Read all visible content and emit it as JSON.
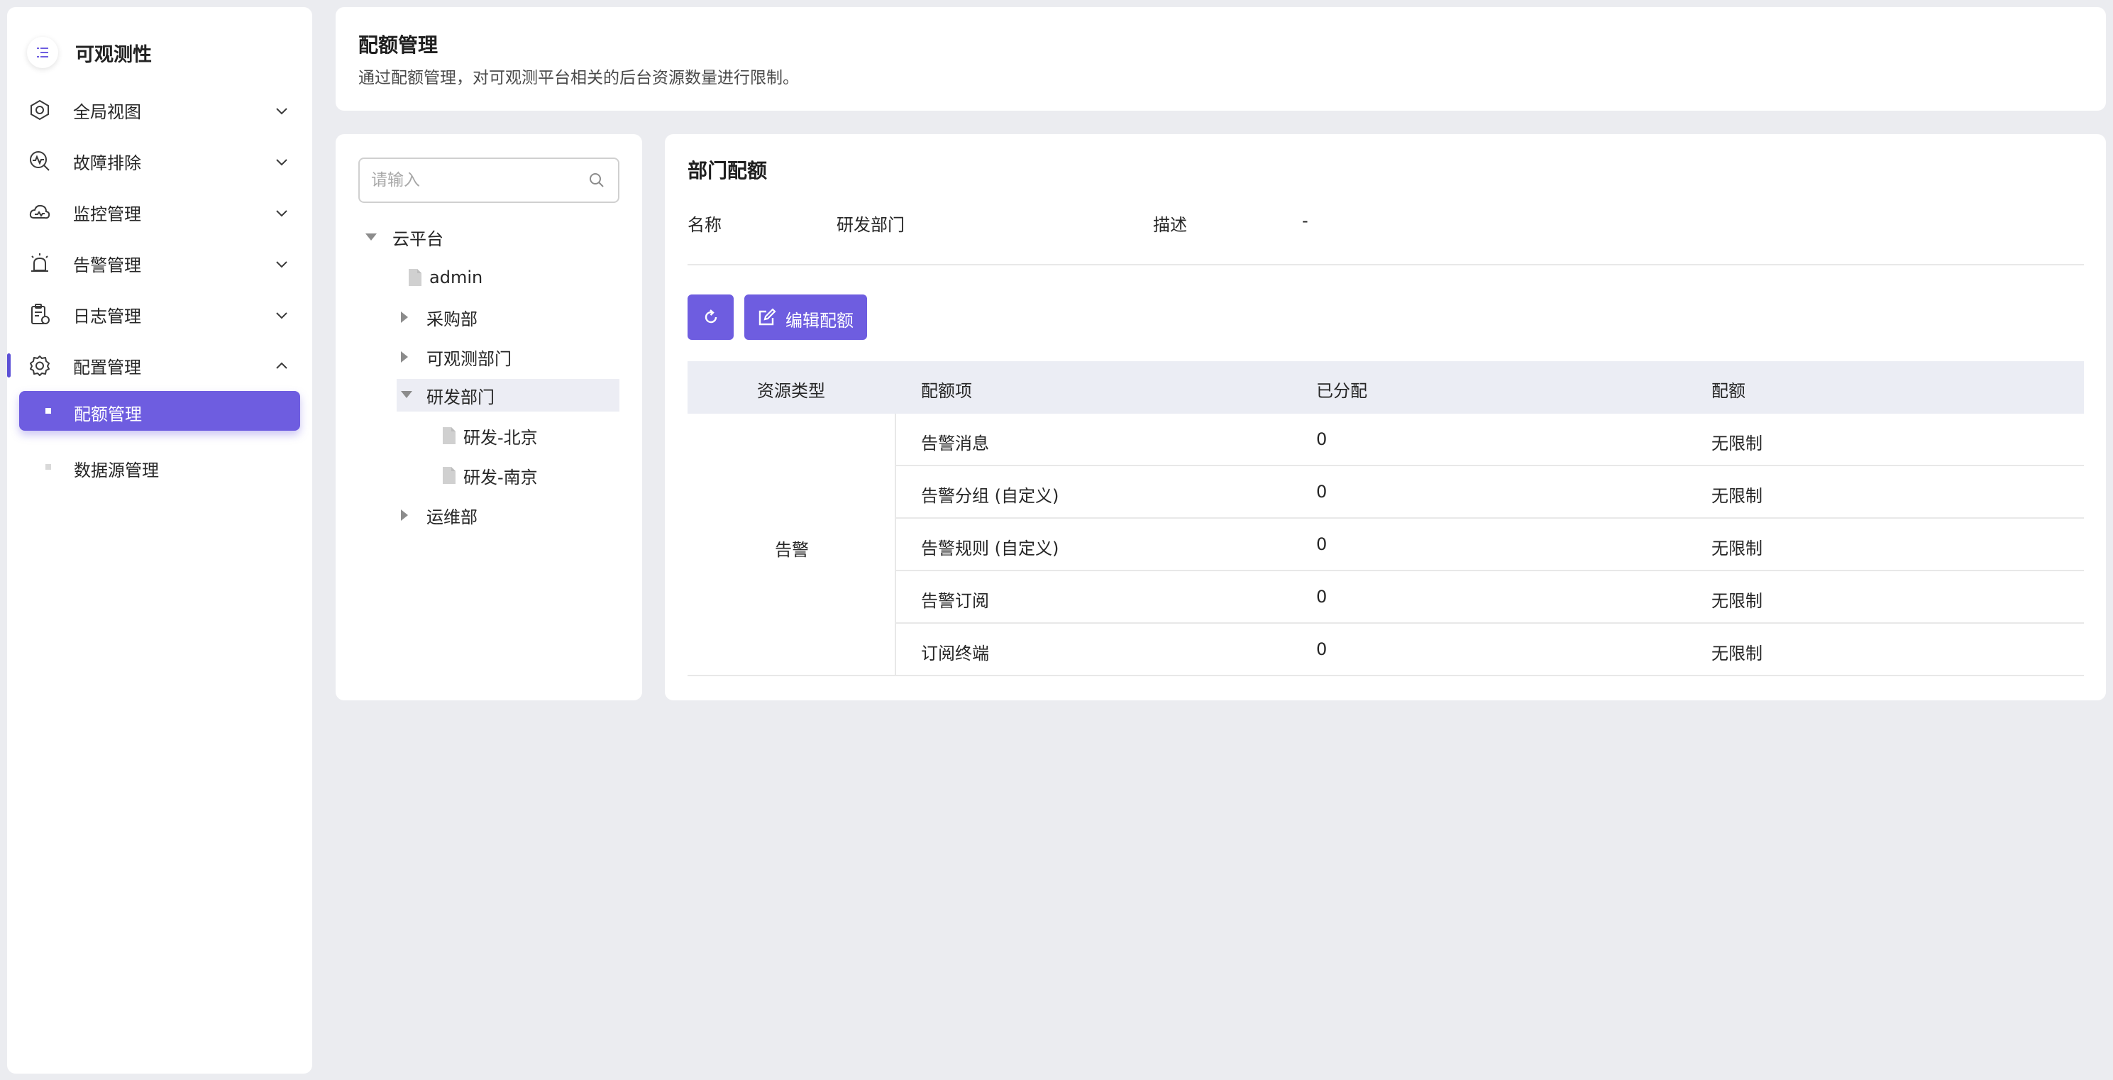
{
  "sidebar": {
    "title": "可观测性",
    "items": [
      {
        "label": "全局视图"
      },
      {
        "label": "故障排除"
      },
      {
        "label": "监控管理"
      },
      {
        "label": "告警管理"
      },
      {
        "label": "日志管理"
      },
      {
        "label": "配置管理"
      }
    ],
    "sub_items": [
      {
        "label": "配额管理"
      },
      {
        "label": "数据源管理"
      }
    ]
  },
  "header": {
    "title": "配额管理",
    "description": "通过配额管理，对可观测平台相关的后台资源数量进行限制。"
  },
  "tree": {
    "search_placeholder": "请输入",
    "nodes": [
      {
        "label": "云平台"
      },
      {
        "label": "admin"
      },
      {
        "label": "采购部"
      },
      {
        "label": "可观测部门"
      },
      {
        "label": "研发部门"
      },
      {
        "label": "研发-北京"
      },
      {
        "label": "研发-南京"
      },
      {
        "label": "运维部"
      }
    ]
  },
  "main": {
    "title": "部门配额",
    "name_label": "名称",
    "name_value": "研发部门",
    "desc_label": "描述",
    "desc_value": "-",
    "edit_button": "编辑配额"
  },
  "table": {
    "headers": [
      "资源类型",
      "配额项",
      "已分配",
      "配额"
    ],
    "group": "告警",
    "rows": [
      {
        "item": "告警消息",
        "allocated": "0",
        "quota": "无限制"
      },
      {
        "item": "告警分组 (自定义)",
        "allocated": "0",
        "quota": "无限制"
      },
      {
        "item": "告警规则 (自定义)",
        "allocated": "0",
        "quota": "无限制"
      },
      {
        "item": "告警订阅",
        "allocated": "0",
        "quota": "无限制"
      },
      {
        "item": "订阅终端",
        "allocated": "0",
        "quota": "无限制"
      }
    ]
  },
  "colors": {
    "accent": "#6e5de0",
    "background": "#ebecf0",
    "table_header": "#ebedf4"
  }
}
